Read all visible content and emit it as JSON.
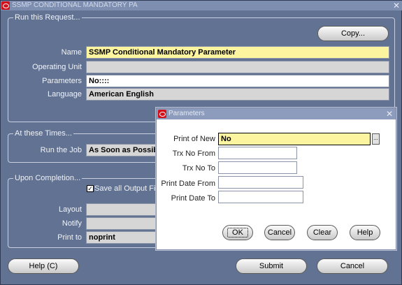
{
  "window": {
    "title": "SSMP CONDITIONAL MANDATORY PA",
    "close_glyph": "✕"
  },
  "run_request": {
    "group_label": "Run this Request...",
    "copy_label": "Copy...",
    "name_label": "Name",
    "name_value": "SSMP Conditional Mandatory Parameter",
    "operating_unit_label": "Operating Unit",
    "operating_unit_value": "",
    "parameters_label": "Parameters",
    "parameters_value": "No::::",
    "language_label": "Language",
    "language_value": "American English"
  },
  "at_times": {
    "group_label": "At these Times...",
    "run_job_label": "Run the Job",
    "run_job_value": "As Soon as Possible"
  },
  "completion": {
    "group_label": "Upon Completion...",
    "save_output_label": "Save all Output Fil",
    "save_output_checked": true,
    "layout_label": "Layout",
    "layout_value": "",
    "notify_label": "Notify",
    "notify_value": "",
    "print_to_label": "Print to",
    "print_to_value": "noprint"
  },
  "footer": {
    "help_label": "Help (C)",
    "submit_label": "Submit",
    "cancel_label": "Cancel"
  },
  "parameters_dialog": {
    "title": "Parameters",
    "close_glyph": "✕",
    "print_of_new_label": "Print of New",
    "print_of_new_value": "No",
    "trx_no_from_label": "Trx No From",
    "trx_no_from_value": "",
    "trx_no_to_label": "Trx No To",
    "trx_no_to_value": "",
    "print_date_from_label": "Print Date From",
    "print_date_from_value": "",
    "print_date_to_label": "Print Date To",
    "print_date_to_value": "",
    "lov_glyph": "...",
    "ok_label": "OK",
    "cancel_label": "Cancel",
    "clear_label": "Clear",
    "help_label": "Help"
  },
  "colors": {
    "window_bg": "#627292",
    "required_field": "#fdf4a0",
    "readonly_field": "#d6d6d6"
  }
}
